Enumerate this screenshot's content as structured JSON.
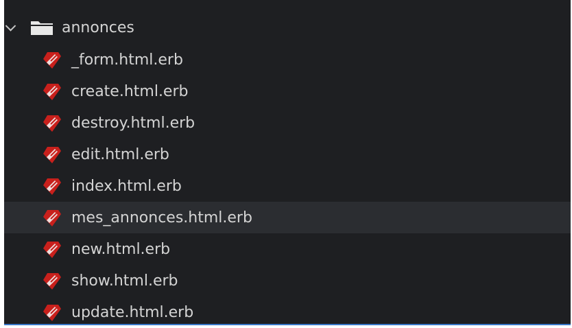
{
  "explorer": {
    "folder": {
      "name": "annonces",
      "expanded": true,
      "icon": "folder-icon"
    },
    "files": [
      {
        "name": "_form.html.erb",
        "icon": "ruby-icon"
      },
      {
        "name": "create.html.erb",
        "icon": "ruby-icon"
      },
      {
        "name": "destroy.html.erb",
        "icon": "ruby-icon"
      },
      {
        "name": "edit.html.erb",
        "icon": "ruby-icon"
      },
      {
        "name": "index.html.erb",
        "icon": "ruby-icon"
      },
      {
        "name": "mes_annonces.html.erb",
        "icon": "ruby-icon",
        "selected": true
      },
      {
        "name": "new.html.erb",
        "icon": "ruby-icon"
      },
      {
        "name": "show.html.erb",
        "icon": "ruby-icon"
      },
      {
        "name": "update.html.erb",
        "icon": "ruby-icon"
      }
    ],
    "colors": {
      "background": "#1e1f22",
      "selected_row": "#2b2d31",
      "text": "#d4d4d4",
      "ruby_red": "#c8201c",
      "folder_fill": "#e8e8e8"
    }
  }
}
